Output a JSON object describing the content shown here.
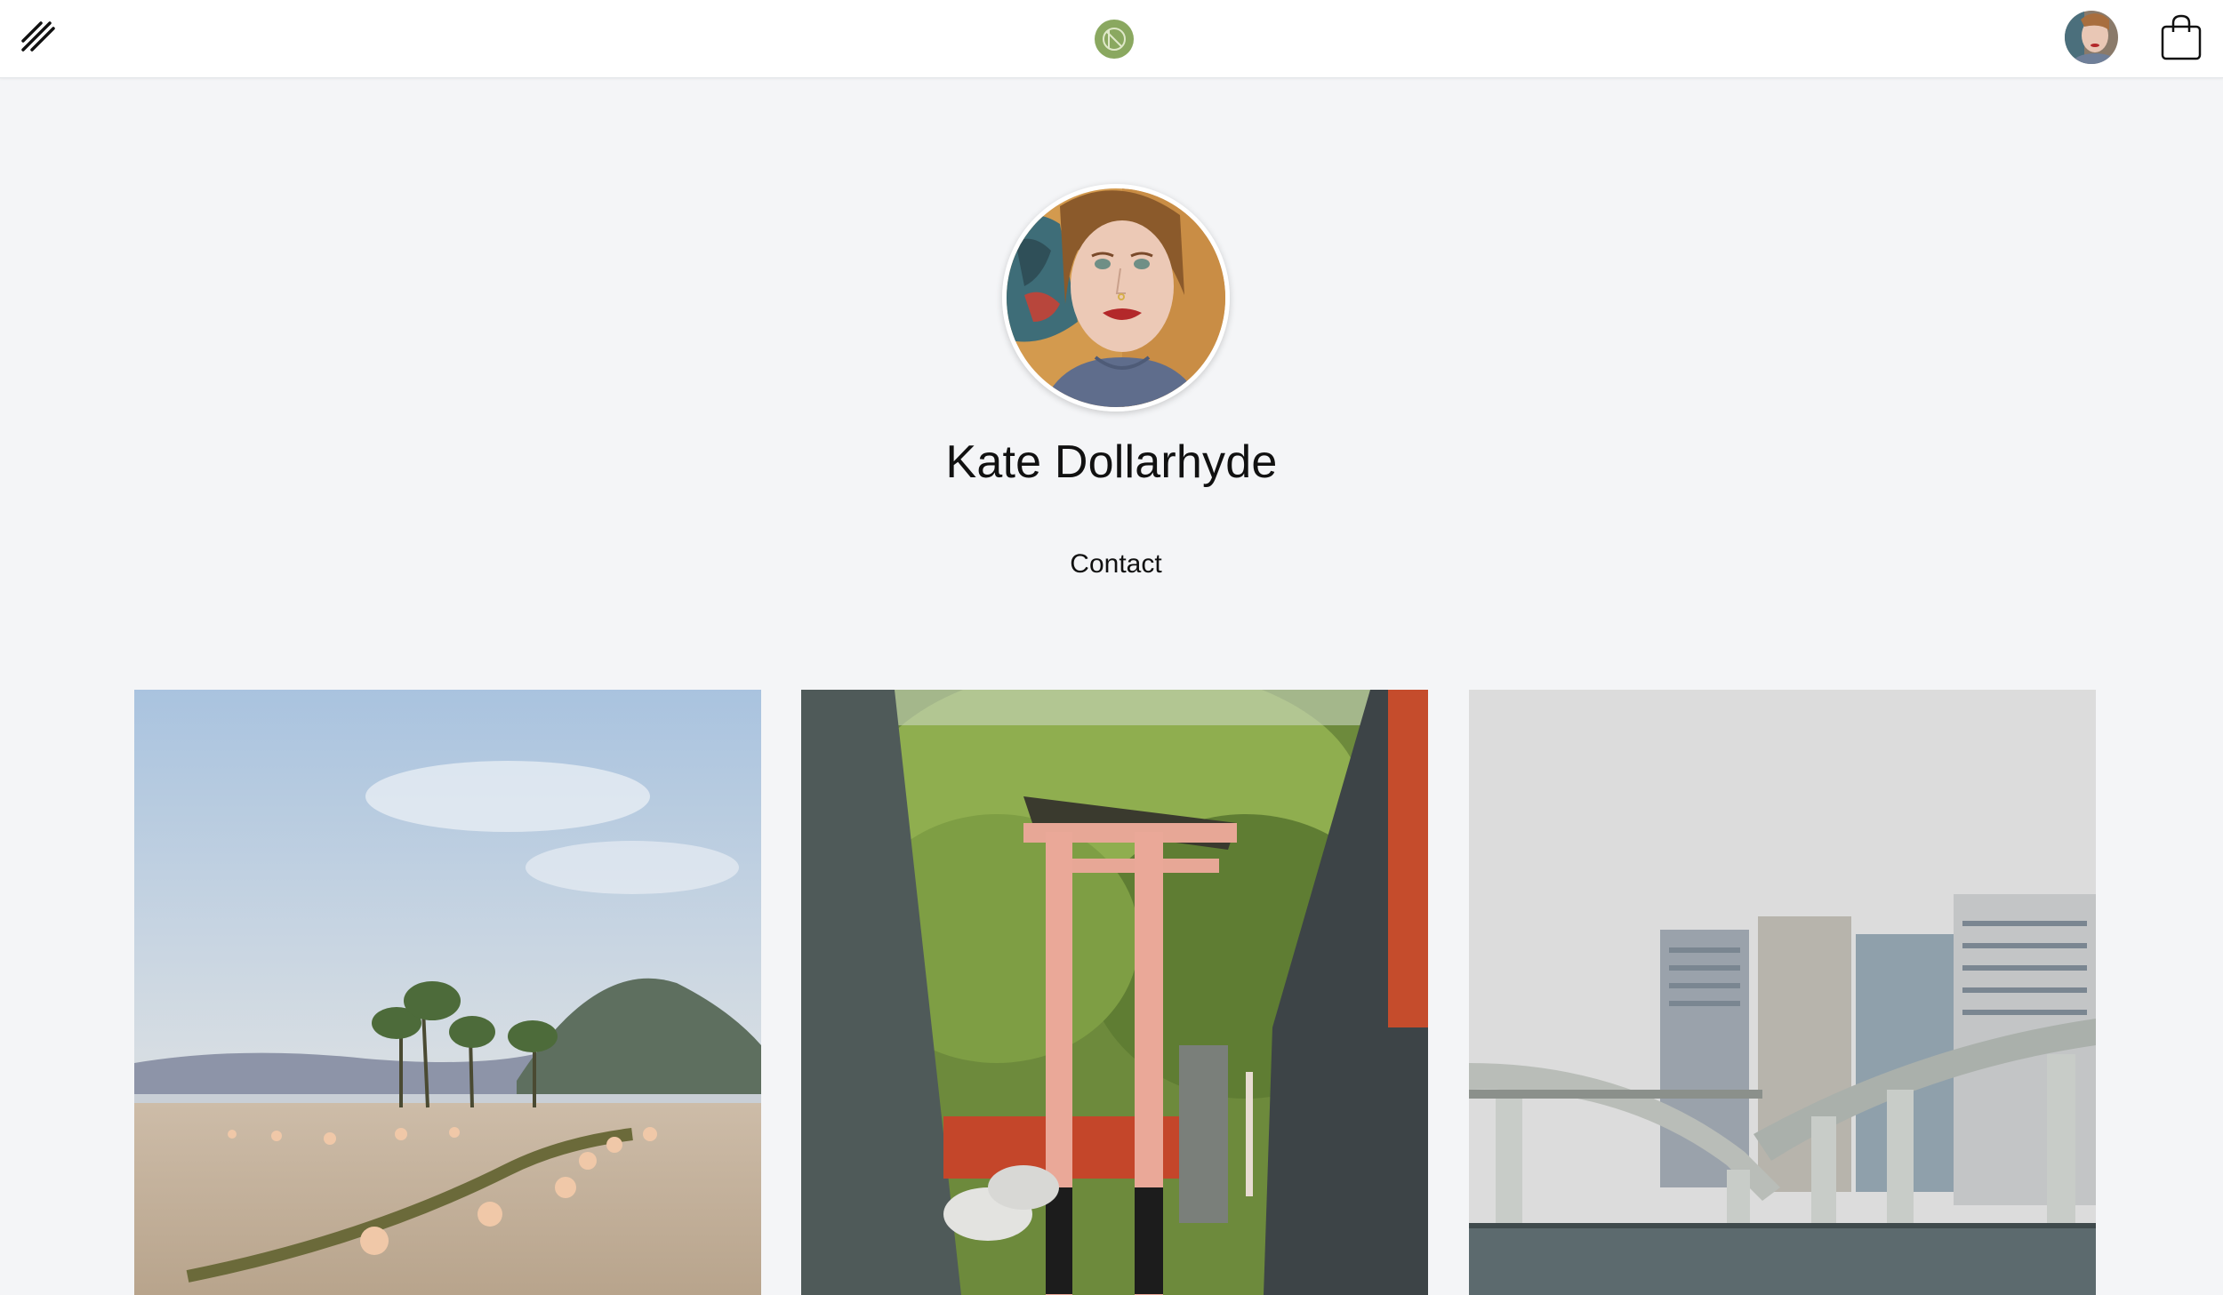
{
  "header": {
    "menu_icon": "hamburger-slash-icon",
    "logo_icon": "brand-logo-icon",
    "user_avatar_icon": "user-avatar",
    "cart_icon": "shopping-bag-icon"
  },
  "profile": {
    "name": "Kate Dollarhyde",
    "contact_label": "Contact"
  },
  "gallery": {
    "photos": [
      {
        "subject": "beach-with-trees-and-mountain"
      },
      {
        "subject": "torii-gate-shrine"
      },
      {
        "subject": "city-highway-over-river"
      }
    ]
  },
  "colors": {
    "background": "#f4f5f7",
    "topbar": "#ffffff",
    "logo": "#8aa860",
    "text": "#111111"
  }
}
